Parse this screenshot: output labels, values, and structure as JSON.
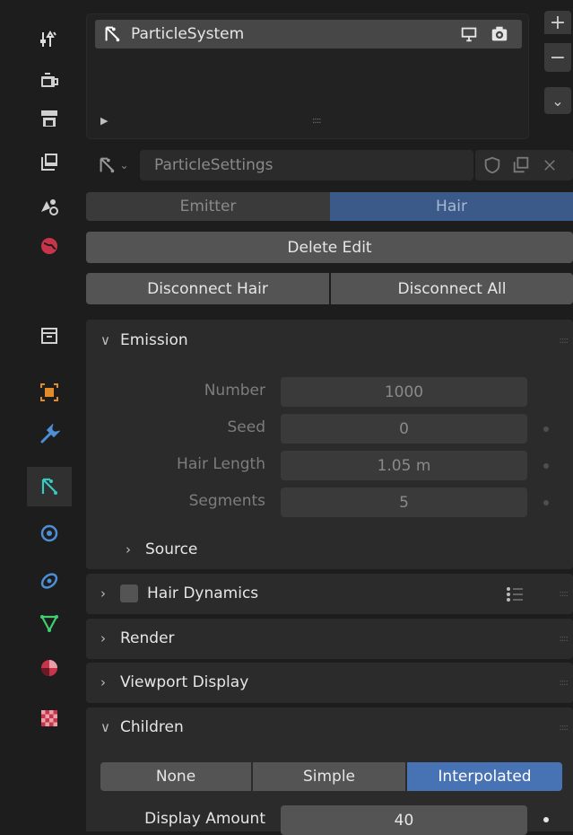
{
  "particle_list": {
    "item_label": "ParticleSystem",
    "add_label": "+",
    "remove_label": "−",
    "menu_label": "⌄",
    "play_glyph": "▶",
    "grip": "::::"
  },
  "settings": {
    "name": "ParticleSettings"
  },
  "type_tabs": {
    "emitter": "Emitter",
    "hair": "Hair",
    "selected": "Hair"
  },
  "buttons": {
    "delete_edit": "Delete Edit",
    "disconnect_hair": "Disconnect Hair",
    "disconnect_all": "Disconnect All"
  },
  "emission": {
    "title": "Emission",
    "fields": [
      {
        "label": "Number",
        "value": "1000"
      },
      {
        "label": "Seed",
        "value": "0"
      },
      {
        "label": "Hair Length",
        "value": "1.05 m"
      },
      {
        "label": "Segments",
        "value": "5"
      }
    ],
    "source": "Source"
  },
  "panels": {
    "hair_dynamics": "Hair Dynamics",
    "render": "Render",
    "viewport_display": "Viewport Display",
    "children": "Children"
  },
  "children": {
    "modes": [
      "None",
      "Simple",
      "Interpolated"
    ],
    "selected": "Interpolated",
    "display_amount_label": "Display Amount",
    "display_amount_value": "40"
  },
  "colors": {
    "accent": "#4772b3",
    "panel": "#2b2b2b",
    "button": "#545454"
  }
}
